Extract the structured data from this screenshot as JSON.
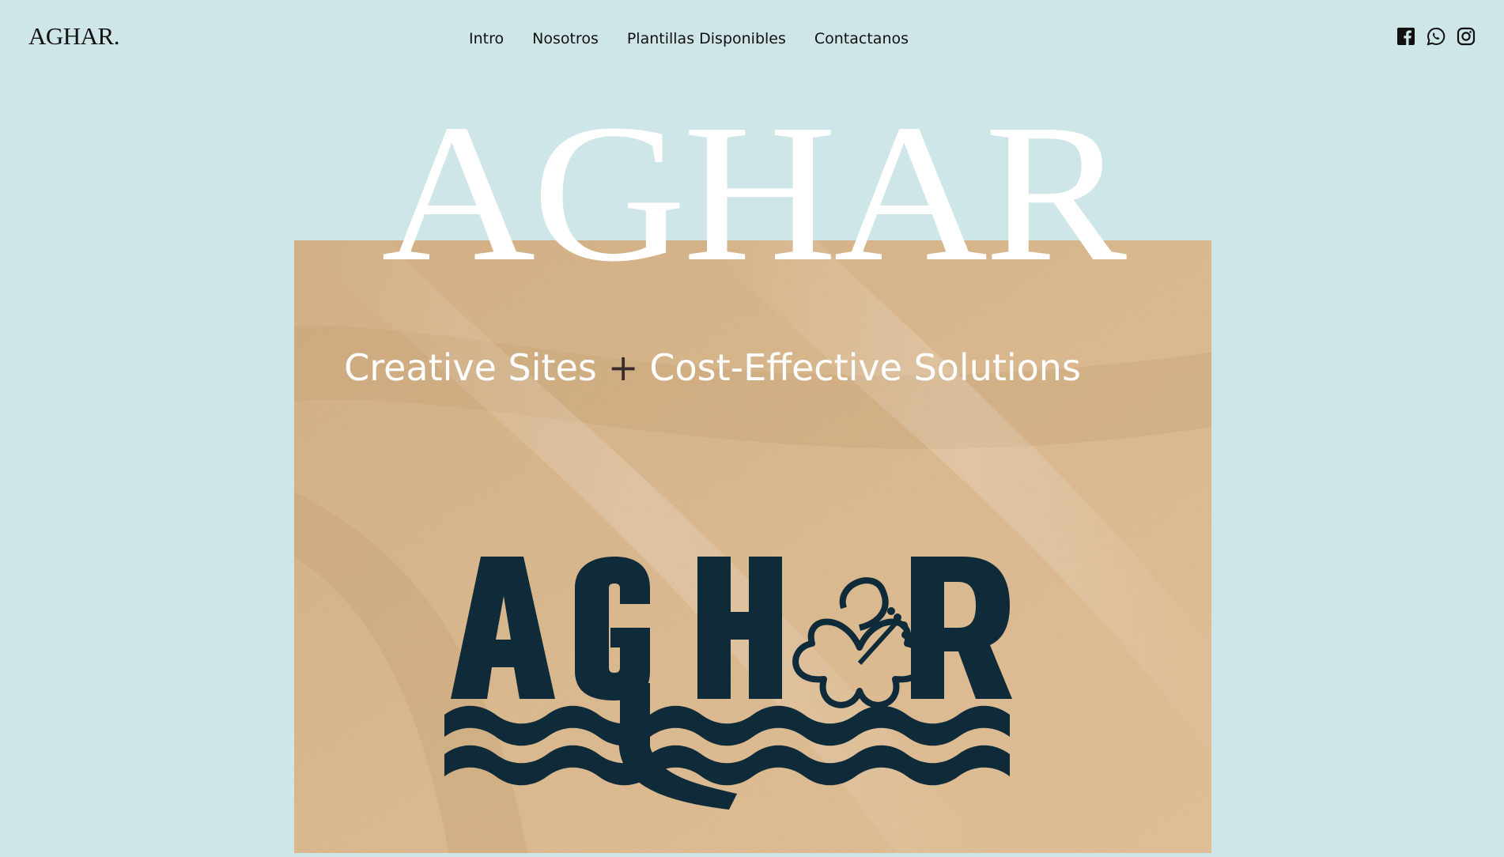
{
  "header": {
    "logo": "AGHAR.",
    "nav": [
      {
        "label": "Intro"
      },
      {
        "label": "Nosotros"
      },
      {
        "label": "Plantillas Disponibles"
      },
      {
        "label": "Contactanos"
      }
    ],
    "social_icons": [
      "facebook-icon",
      "whatsapp-icon",
      "instagram-icon"
    ]
  },
  "hero": {
    "title": "AGHAR",
    "tagline_left": "Creative Sites",
    "tagline_plus": "+",
    "tagline_right": "Cost-Effective Solutions",
    "logo_text": "AGHAR"
  },
  "colors": {
    "background": "#cfe6e8",
    "sand": "#d9b487",
    "logo_navy": "#0f2a38",
    "text": "#111111",
    "white": "#ffffff"
  }
}
